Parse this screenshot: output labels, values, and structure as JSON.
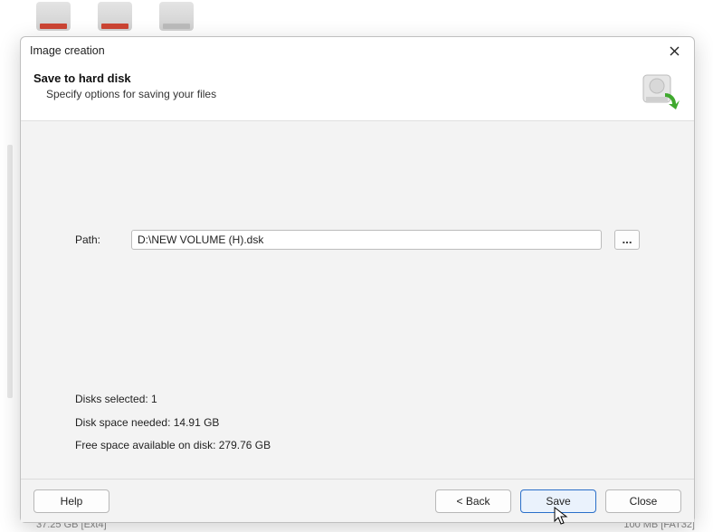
{
  "background": {
    "footer_left": "37.25 GB [Ext4]",
    "footer_right": "100 MB [FAT32]"
  },
  "dialog": {
    "title": "Image creation",
    "header": {
      "heading": "Save to hard disk",
      "subtext": "Specify options for saving your files"
    },
    "path": {
      "label": "Path:",
      "value": "D:\\NEW VOLUME (H).dsk",
      "browse_label": "..."
    },
    "stats": {
      "disks_selected": "Disks selected: 1",
      "space_needed": "Disk space needed: 14.91 GB",
      "free_space": "Free space available on disk: 279.76 GB"
    },
    "buttons": {
      "help": "Help",
      "back": "< Back",
      "save": "Save",
      "close": "Close"
    }
  }
}
